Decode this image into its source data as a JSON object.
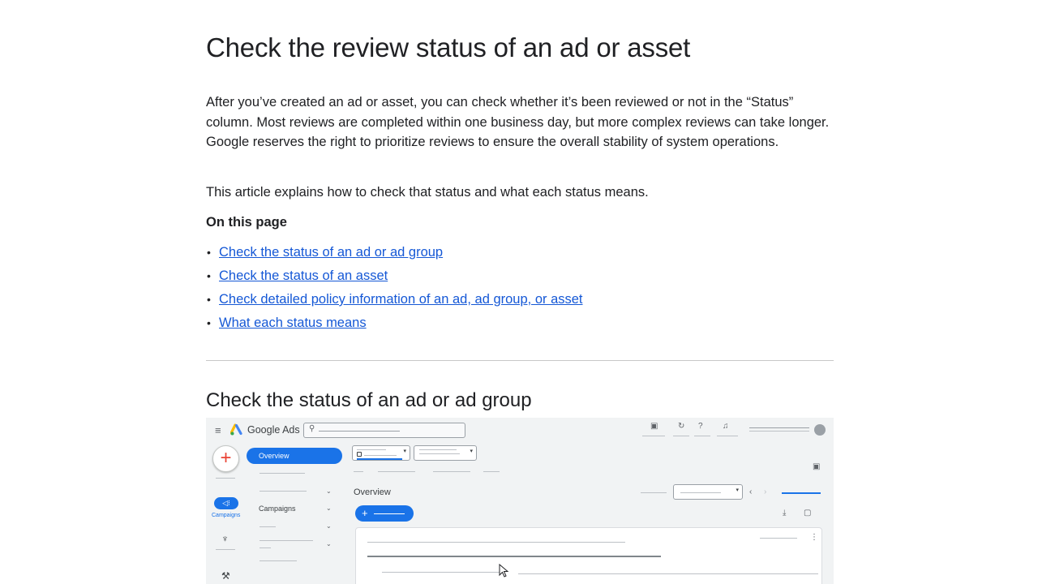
{
  "article": {
    "title": "Check the review status of an ad or asset",
    "intro": "After you’ve created an ad or asset, you can check whether it’s been reviewed or not in the “Status” column. Most reviews are completed within one business day, but more complex reviews can take longer. Google reserves the right to prioritize reviews to ensure the overall stability of system operations.",
    "explain": "This article explains how to check that status and what each status means.",
    "on_this_page": "On this page",
    "toc": [
      {
        "label": "Check the status of an ad or ad group"
      },
      {
        "label": "Check the status of an asset"
      },
      {
        "label": "Check detailed policy information of an ad, ad group, or asset"
      },
      {
        "label": "What each status means"
      }
    ],
    "section_heading": "Check the status of an ad or ad group"
  },
  "screenshot": {
    "brand": "Google Ads",
    "nav_overview": "Overview",
    "nav_campaigns_icon_label": "Campaigns",
    "side_campaigns": "Campaigns",
    "main_title": "Overview",
    "icons": {
      "menu": "menu-icon",
      "search": "search-icon",
      "create": "plus-icon",
      "campaigns": "megaphone-icon",
      "goals": "trophy-icon",
      "tools": "tools-icon"
    },
    "colors": {
      "accent": "#1a73e8",
      "link": "#1558d6"
    }
  }
}
